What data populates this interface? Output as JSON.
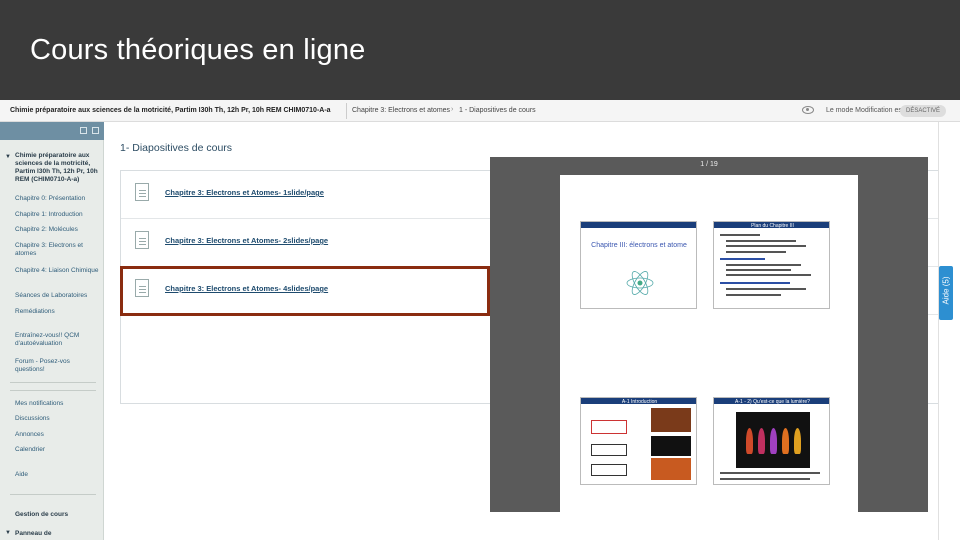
{
  "slide": {
    "title": "Cours théoriques en ligne"
  },
  "topbar": {
    "course": "Chimie préparatoire aux sciences de la motricité, Partim I30h Th, 12h Pr, 10h REM CHIM0710-A-a",
    "breadcrumb_chapter": "Chapitre 3: Electrons et atomes",
    "breadcrumb_arrow": "›",
    "breadcrumb_current": "1 - Diapositives de cours",
    "mode_label": "Le mode Modification est :",
    "mode_state": "DÉSACTIVÉ"
  },
  "sidebar": {
    "course_title": "Chimie préparatoire aux sciences de la motricité, Partim I30h Th, 12h Pr, 10h REM (CHIM0710-A-a)",
    "items": [
      "Chapitre 0: Présentation",
      "Chapitre 1: Introduction",
      "Chapitre 2: Molécules",
      "Chapitre 3: Electrons et atomes",
      "Chapitre 4: Liaison Chimique",
      "Séances de Laboratoires",
      "Remédiations",
      "Entraînez-vous!! QCM d'autoévaluation",
      "Forum - Posez-vos questions!",
      "Mes notifications",
      "Discussions",
      "Annonces",
      "Calendrier",
      "Aide"
    ],
    "section_gestion": "Gestion de cours",
    "section_panneau": "Panneau de"
  },
  "main": {
    "title": "1- Diapositives de cours",
    "files": [
      "Chapitre 3: Electrons et Atomes- 1slide/page",
      "Chapitre 3: Electrons et Atomes- 2slides/page",
      "Chapitre 3: Electrons et Atomes- 4slides/page"
    ]
  },
  "viewer": {
    "counter": "1 / 19",
    "thumb1_title": "Chapitre III: électrons et atome",
    "thumb2_header": "Plan du Chapitre III",
    "thumb3_header": "A-1 Introduction",
    "thumb4_header": "A-1 - 2) Qu'est-ce que la lumière?"
  },
  "aide": {
    "label": "Aide (5)"
  },
  "colors": {
    "slide_bg": "#3a3a3a",
    "sidebar_bg": "#e8ece9",
    "sidebar_header": "#6e8fa3",
    "link": "#1e4b6e",
    "highlight_border": "#8a2c10",
    "aide_blue": "#2d8fd1"
  }
}
